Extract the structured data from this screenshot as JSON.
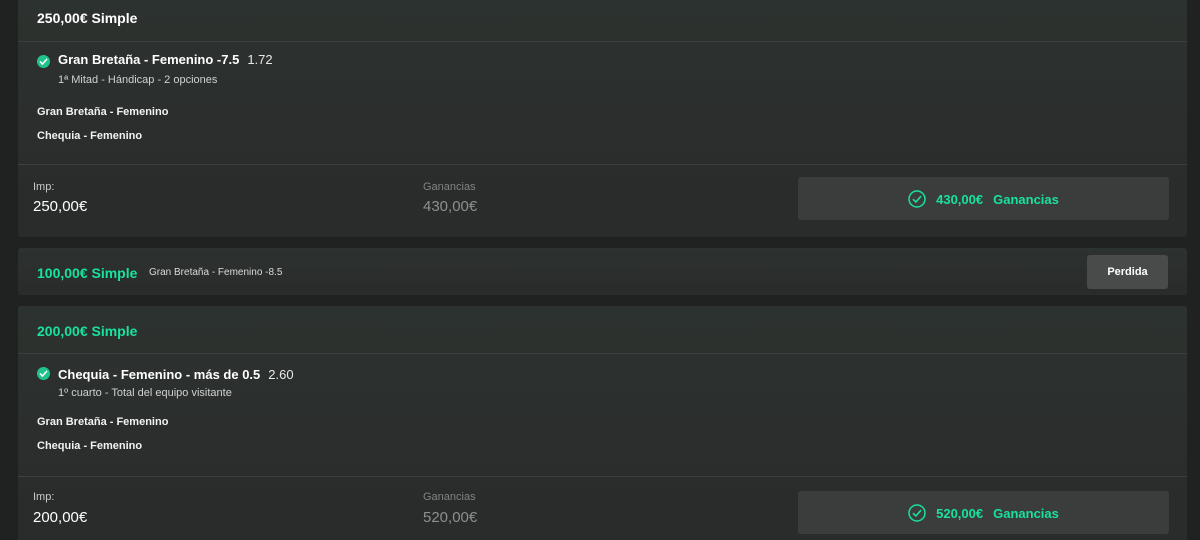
{
  "bets": [
    {
      "title": "250,00€ Simple",
      "selection": "Gran Bretaña - Femenino -7.5",
      "odds": "1.72",
      "market": "1ª Mitad - Hándicap - 2 opciones",
      "team_home": "Gran Bretaña - Femenino",
      "team_away": "Chequia - Femenino",
      "stake_label": "Imp:",
      "stake_value": "250,00€",
      "winnings_label": "Ganancias",
      "winnings_value": "430,00€",
      "result_amount": "430,00€",
      "result_word": "Ganancias",
      "status": "won"
    },
    {
      "title": "100,00€ Simple",
      "selection": "Gran Bretaña - Femenino -8.5",
      "status_label": "Perdida",
      "status": "lost"
    },
    {
      "title": "200,00€ Simple",
      "selection": "Chequia - Femenino - más de 0.5",
      "odds": "2.60",
      "market": "1º cuarto - Total del equipo visitante",
      "team_home": "Gran Bretaña - Femenino",
      "team_away": "Chequia - Femenino",
      "stake_label": "Imp:",
      "stake_value": "200,00€",
      "winnings_label": "Ganancias",
      "winnings_value": "520,00€",
      "result_amount": "520,00€",
      "result_word": "Ganancias",
      "status": "won"
    }
  ],
  "colors": {
    "accent": "#18e2a0",
    "check": "#20c38b",
    "background": "#202121",
    "card": "#2c302e",
    "result_box": "#3b3c3c",
    "lost_button": "#494a4a"
  },
  "icons": {
    "selection_status": "check-circle-icon",
    "result_status": "check-circle-outline-icon"
  }
}
